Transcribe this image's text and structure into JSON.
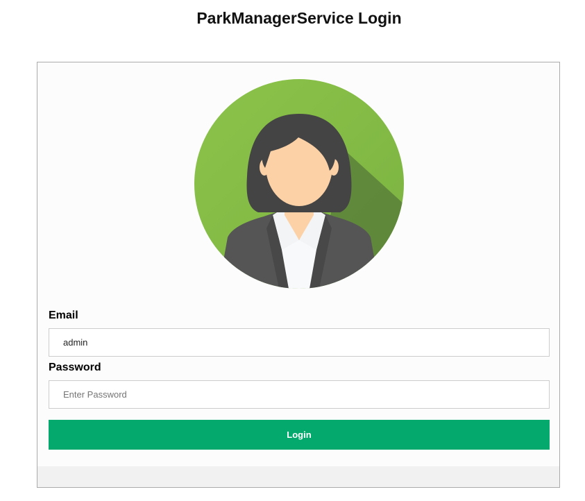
{
  "page": {
    "title": "ParkManagerService Login"
  },
  "form": {
    "email_label": "Email",
    "email_value": "admin",
    "password_label": "Password",
    "password_placeholder": "Enter Password",
    "password_value": "",
    "login_button_label": "Login"
  },
  "avatar": {
    "icon": "user-avatar-icon"
  },
  "colors": {
    "button": "#04aa6d",
    "avatar_background": "#8bc34a",
    "avatar_shadow": "#5a803a",
    "hair": "#444444",
    "skin": "#fcd1a6",
    "suit": "#555555",
    "shirt": "#f8f9fb",
    "footer": "#f1f1f1"
  }
}
